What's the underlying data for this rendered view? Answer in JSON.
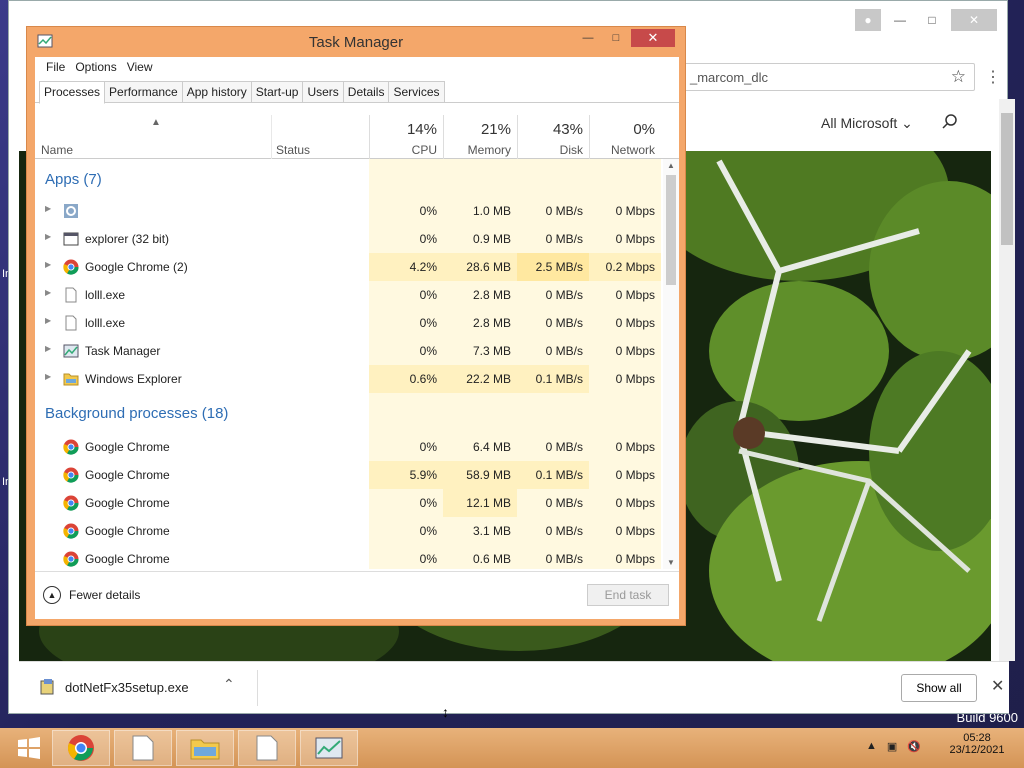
{
  "desktop": {
    "text_a": "In",
    "text_b": "In",
    "build": "Build 9600"
  },
  "chrome": {
    "omnibox_text": "_marcom_dlc",
    "all_microsoft": "All Microsoft",
    "download": {
      "filename": "dotNetFx35setup.exe",
      "show_all": "Show all"
    }
  },
  "taskmanager": {
    "title": "Task Manager",
    "menu": [
      "File",
      "Options",
      "View"
    ],
    "tabs": [
      "Processes",
      "Performance",
      "App history",
      "Start-up",
      "Users",
      "Details",
      "Services"
    ],
    "columns": {
      "name": "Name",
      "status": "Status",
      "cpu": {
        "pct": "14%",
        "label": "CPU"
      },
      "memory": {
        "pct": "21%",
        "label": "Memory"
      },
      "disk": {
        "pct": "43%",
        "label": "Disk"
      },
      "network": {
        "pct": "0%",
        "label": "Network"
      }
    },
    "group_apps": "Apps (7)",
    "group_bg": "Background processes (18)",
    "apps": [
      {
        "name": "",
        "icon": "gear-icon",
        "cpu": "0%",
        "mem": "1.0 MB",
        "disk": "0 MB/s",
        "net": "0 Mbps"
      },
      {
        "name": "explorer (32 bit)",
        "icon": "window-icon",
        "cpu": "0%",
        "mem": "0.9 MB",
        "disk": "0 MB/s",
        "net": "0 Mbps"
      },
      {
        "name": "Google Chrome (2)",
        "icon": "chrome-icon",
        "cpu": "4.2%",
        "mem": "28.6 MB",
        "disk": "2.5 MB/s",
        "net": "0.2 Mbps"
      },
      {
        "name": "lolll.exe",
        "icon": "file-icon",
        "cpu": "0%",
        "mem": "2.8 MB",
        "disk": "0 MB/s",
        "net": "0 Mbps"
      },
      {
        "name": "lolll.exe",
        "icon": "file-icon",
        "cpu": "0%",
        "mem": "2.8 MB",
        "disk": "0 MB/s",
        "net": "0 Mbps"
      },
      {
        "name": "Task Manager",
        "icon": "taskmanager-icon",
        "cpu": "0%",
        "mem": "7.3 MB",
        "disk": "0 MB/s",
        "net": "0 Mbps"
      },
      {
        "name": "Windows Explorer",
        "icon": "folder-icon",
        "cpu": "0.6%",
        "mem": "22.2 MB",
        "disk": "0.1 MB/s",
        "net": "0 Mbps"
      }
    ],
    "background": [
      {
        "name": "Google Chrome",
        "cpu": "0%",
        "mem": "6.4 MB",
        "disk": "0 MB/s",
        "net": "0 Mbps"
      },
      {
        "name": "Google Chrome",
        "cpu": "5.9%",
        "mem": "58.9 MB",
        "disk": "0.1 MB/s",
        "net": "0 Mbps"
      },
      {
        "name": "Google Chrome",
        "cpu": "0%",
        "mem": "12.1 MB",
        "disk": "0 MB/s",
        "net": "0 Mbps"
      },
      {
        "name": "Google Chrome",
        "cpu": "0%",
        "mem": "3.1 MB",
        "disk": "0 MB/s",
        "net": "0 Mbps"
      },
      {
        "name": "Google Chrome",
        "cpu": "0%",
        "mem": "0.6 MB",
        "disk": "0 MB/s",
        "net": "0 Mbps"
      }
    ],
    "fewer_details": "Fewer details",
    "end_task": "End task"
  },
  "taskbar": {
    "time": "05:28",
    "date": "23/12/2021"
  },
  "colors": {
    "tm_frame": "#f4a76a",
    "taskbar": "#d49456",
    "group_text": "#2e6db4"
  }
}
